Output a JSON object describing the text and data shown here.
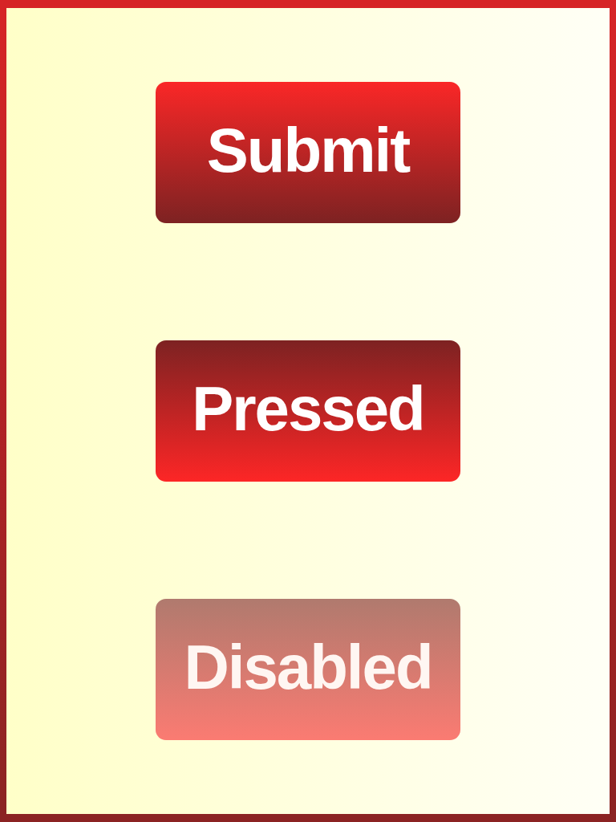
{
  "buttons": [
    {
      "label": "Submit",
      "pressed": false,
      "disabled": false
    },
    {
      "label": "Pressed",
      "pressed": true,
      "disabled": false
    },
    {
      "label": "Disabled",
      "pressed": false,
      "disabled": true
    }
  ]
}
